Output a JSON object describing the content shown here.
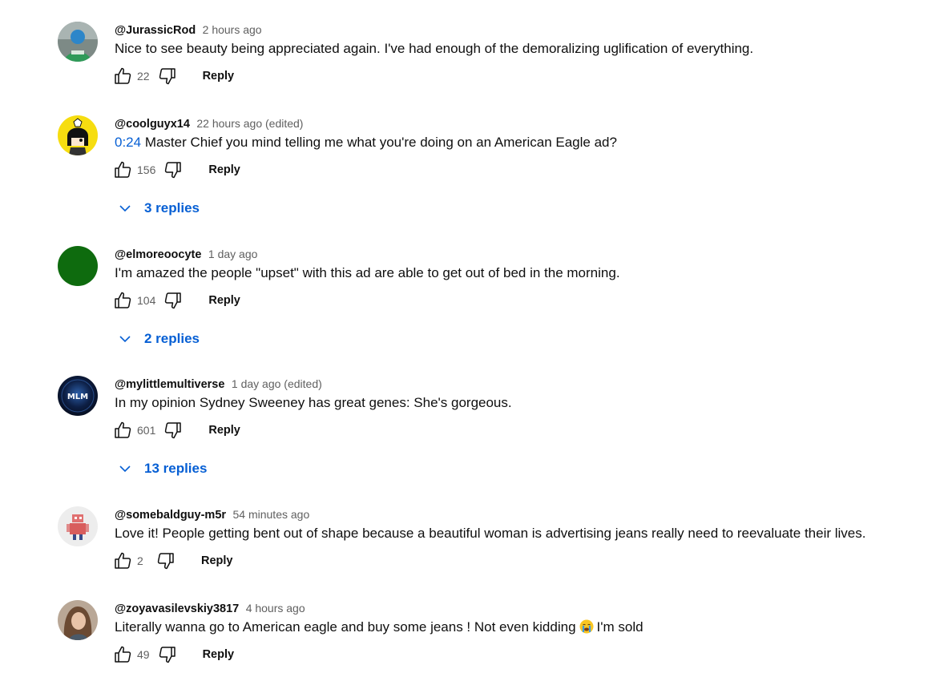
{
  "comments": [
    {
      "author": "@JurassicRod",
      "time": "2 hours ago",
      "text": "Nice to see beauty being appreciated again. I've had enough of the demoralizing uglification of everything.",
      "likes": "22",
      "reply_label": "Reply",
      "avatar_icon": "avatar-icon-person"
    },
    {
      "author": "@coolguyx14",
      "time": "22 hours ago (edited)",
      "timestamp_link": "0:24",
      "text": " Master Chief you mind telling me what you're doing on an American Eagle ad?",
      "likes": "156",
      "reply_label": "Reply",
      "replies": "3 replies",
      "avatar_icon": "avatar-icon-cartoon"
    },
    {
      "author": "@elmoreoocyte",
      "time": "1 day ago",
      "text": "I'm amazed the people \"upset\" with this ad are able to get out of bed in the morning.",
      "likes": "104",
      "reply_label": "Reply",
      "replies": "2 replies",
      "avatar_icon": "avatar-icon-green"
    },
    {
      "author": "@mylittlemultiverse",
      "time": "1 day ago (edited)",
      "text": "In my opinion Sydney Sweeney has great genes: She's gorgeous.",
      "likes": "601",
      "reply_label": "Reply",
      "replies": "13 replies",
      "avatar_icon": "avatar-icon-mlm",
      "avatar_text": "MLM"
    },
    {
      "author": "@somebaldguy-m5r",
      "time": "54 minutes ago",
      "text": "Love it! People getting bent out of shape because a beautiful woman is advertising jeans really need to reevaluate their lives.",
      "likes": "2",
      "reply_label": "Reply",
      "avatar_icon": "avatar-icon-robot"
    },
    {
      "author": "@zoyavasilevskiy3817",
      "time": "4 hours ago",
      "text_before": "Literally wanna go to American eagle and buy some jeans ! Not even kidding",
      "text_after": "I'm sold",
      "emoji_icon": "crying-face-icon",
      "likes": "49",
      "reply_label": "Reply",
      "avatar_icon": "avatar-icon-person"
    }
  ],
  "colors": {
    "link_blue": "#065fd4",
    "secondary_text": "#606060",
    "primary_text": "#0f0f0f"
  }
}
